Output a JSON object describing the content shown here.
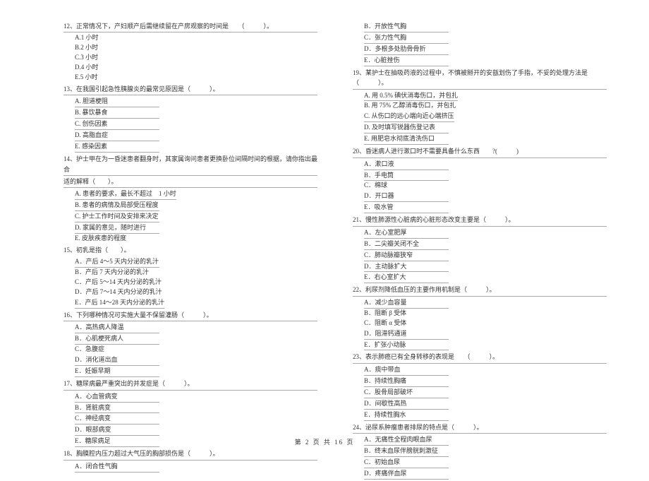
{
  "left": {
    "q12": {
      "title": "12、正常情况下，产妇顺产后需继续留在产房观察的时间是　　（　　　）。",
      "a": "A.1 小时",
      "b": "B.2 小时",
      "c": "C.3 小时",
      "d": "D.4 小时",
      "e": "E.5 小时"
    },
    "q13": {
      "title": "13、在我国引起急性胰腺炎的最常见原因是（　　　）。",
      "a": "A. 胆道梗阻",
      "b": "B. 暴饮暴食",
      "c": "C. 创伤因素",
      "d": "D. 高脂血症",
      "e": "E. 感染因素"
    },
    "q14": {
      "title1": "14、护士甲在为一昏迷患者翻身时，其家属询问患者更换卧位间隔时间的根据，请你指出最合",
      "title2": "适的解释（　　）。",
      "a": "A. 患者的要求，最长不超过　1 小时",
      "b": "B. 患者的病情及局部受压程度",
      "c": "C. 护士工作时间及安排来决定",
      "d": "D. 家属的意见，随时进行",
      "e": "E. 皮肤疾患的程度"
    },
    "q15": {
      "title": "15、初乳是指（　　）。",
      "a": "A．产后 4～5 天内分泌的乳汁",
      "b": "B．产后 7 天内分泌的乳汁",
      "c": "C．产后 5～14 天内分泌的乳汁",
      "d": "D．产后 7～14 天内分泌的乳汁",
      "e": "E．产后 14～28 天内分泌的乳汁"
    },
    "q16": {
      "title": "16、下列哪种情况可实施大量不保留灌肠（　　　）。",
      "a": "A．高热病人降温",
      "b": "B．心肌梗死病人",
      "c": "C．急腹症",
      "d": "D．消化道出血",
      "e": "E．妊娠早期"
    },
    "q17": {
      "title": "17、糖尿病最严重突出的并发症是（　　　）。",
      "a": "A．心血管病变",
      "b": "B．肾脏病变",
      "c": "C．神经病变",
      "d": "D．眼部病变",
      "e": "E．糖尿病足"
    },
    "q18": {
      "title": "18、胸膜腔内压力超过大气压的胸部损伤是（　　　）。",
      "a": "A．闭合性气胸"
    }
  },
  "right": {
    "q18r": {
      "b": "B．开放性气胸",
      "c": "C．张力性气胸",
      "d": "D．多根多处肋骨骨折",
      "e": "E．心脏挫伤"
    },
    "q19": {
      "title": "19、某护士在抽吸药液的过程中，不慎被掰开的安瓿划伤了手指，不妥的处理方法是（　　　）。",
      "a": "A. 用 0.5% 碘伏消毒伤口，并包扎",
      "b": "B. 用 75% 乙醇消毒伤口，并包扎",
      "c": "C. 从伤口的远心端向近心端挤压",
      "d": "D. 及时填写锐器伤登记表",
      "e": "E. 用肥皂水彻底清洗伤口"
    },
    "q20": {
      "title": "20、昏迷病人进行漱口时不需要具备什么东西　　?(　　　)",
      "a": "A．漱口液",
      "b": "B．手电筒",
      "c": "C．棉球",
      "d": "D．开口器",
      "e": "E．吸水管"
    },
    "q21": {
      "title": "21、慢性肺源性心脏病的心脏形态改变主要是（　　　）。",
      "a": "A．左心室肥厚",
      "b": "B．二尖瓣关闭不全",
      "c": "C．肺动脉瓣狭窄",
      "d": "D．主动脉扩大",
      "e": "E．右心室扩大"
    },
    "q22": {
      "title": "22、利尿剂降低血压的主要作用机制是（　　　）。",
      "a": "A．减少血容量",
      "b": "B．阻断 β 受体",
      "c": "C．阻断 α 受体",
      "d": "D．阻滞钙通道",
      "e": "E．扩张小动脉"
    },
    "q23": {
      "title": "23、表示肺癌已有全身转移的表现是　　（　　　）。",
      "a": "A．痰中带血",
      "b": "B．持续性胸痛",
      "c": "C．股骨局部破坏",
      "d": "D．间歇性高热",
      "e": "E．持续性胸水"
    },
    "q24": {
      "title": "24、泌尿系肿瘤患者排尿的特点是（　　　）。",
      "a": "A．无痛性全程肉眼血尿",
      "b": "B．终末血尿伴膀胱刺激征",
      "c": "C．初始血尿",
      "d": "D．疼痛伴血尿"
    }
  },
  "footer": "第 2 页 共 16 页"
}
